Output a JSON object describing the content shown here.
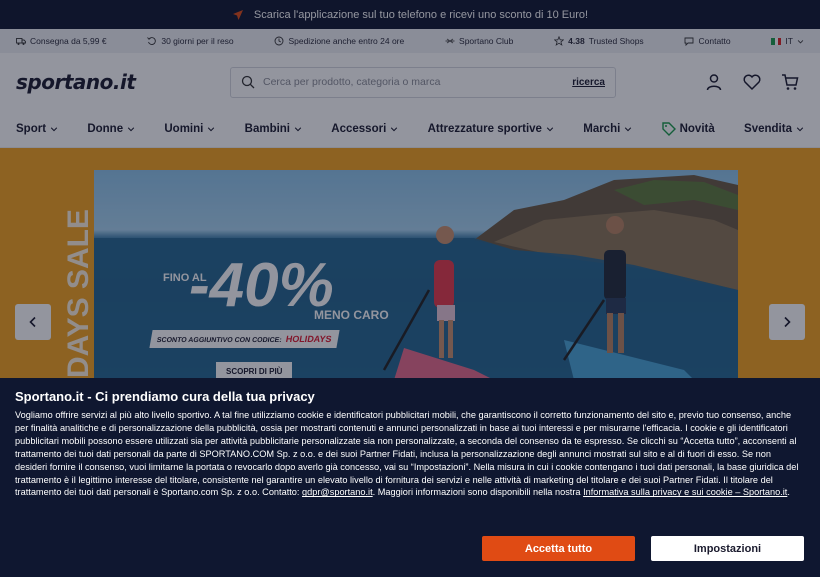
{
  "promo_bar": {
    "text": "Scarica l'applicazione sul tuo telefono e ricevi uno sconto di 10 Euro!",
    "icon": "paper-plane-icon"
  },
  "info_bar": {
    "items": [
      {
        "icon": "truck-icon",
        "label": "Consegna da 5,99 €"
      },
      {
        "icon": "return-icon",
        "label": "30 giorni per il reso"
      },
      {
        "icon": "clock-icon",
        "label": "Spedizione anche entro 24 ore"
      },
      {
        "icon": "club-icon",
        "label": "Sportano Club"
      },
      {
        "icon": "star-icon",
        "rating": "4.38",
        "label": "Trusted Shops"
      },
      {
        "icon": "chat-icon",
        "label": "Contatto"
      }
    ],
    "language": "IT"
  },
  "header": {
    "logo": "sportano.it",
    "search": {
      "placeholder": "Cerca per prodotto, categoria o marca",
      "button": "ricerca"
    },
    "icons": [
      "user-icon",
      "heart-icon",
      "cart-icon"
    ]
  },
  "nav": {
    "items": [
      "Sport",
      "Donne",
      "Uomini",
      "Bambini",
      "Accessori",
      "Attrezzature sportive",
      "Marchi",
      "Novità",
      "Svendita"
    ]
  },
  "hero": {
    "side_text": "DAYS SALE",
    "fino": "FINO AL",
    "percent": "-40%",
    "meno": "MENO CARO",
    "code_label": "SCONTO AGGIUNTIVO CON CODICE:",
    "code": "HOLIDAYS",
    "cta": "SCOPRI DI PIÙ"
  },
  "cookie": {
    "title": "Sportano.it - Ci prendiamo cura della tua privacy",
    "body": "Vogliamo offrire servizi al più alto livello sportivo. A tal fine utilizziamo cookie e identificatori pubblicitari mobili, che garantiscono il corretto funzionamento del sito e, previo tuo consenso, anche per finalità analitiche e di personalizzazione della pubblicità, ossia per mostrarti contenuti e annunci personalizzati in base ai tuoi interessi e per misurarne l'efficacia. I cookie e gli identificatori pubblicitari mobili possono essere utilizzati sia per attività pubblicitarie personalizzate sia non personalizzate, a seconda del consenso da te espresso. Se clicchi su “Accetta tutto”, acconsenti al trattamento dei tuoi dati personali da parte di SPORTANO.COM Sp. z o.o. e dei suoi Partner Fidati, inclusa la personalizzazione degli annunci mostrati sul sito e al di fuori di esso. Se non desideri fornire il consenso, vuoi limitarne la portata o revocarlo dopo averlo già concesso, vai su “Impostazioni”. Nella misura in cui i cookie contengano i tuoi dati personali, la base giuridica del trattamento è il legittimo interesse del titolare, consistente nel garantire un elevato livello di fornitura dei servizi e nelle attività di marketing del titolare e dei suoi Partner Fidati. Il titolare del trattamento dei tuoi dati personali è Sportano.com Sp. z o.o. Contatto: ",
    "email": "gdpr@sportano.it",
    "body_after": ". Maggiori informazioni sono disponibili nella nostra ",
    "policy_link": "Informativa sulla privacy e sui cookie – Sportano.it",
    "end": ".",
    "accept": "Accetta tutto",
    "settings": "Impostazioni"
  },
  "colors": {
    "dark": "#0f1730",
    "accent": "#e04b14",
    "hero_bg": "#f4a21e",
    "code_red": "#e0192e"
  }
}
